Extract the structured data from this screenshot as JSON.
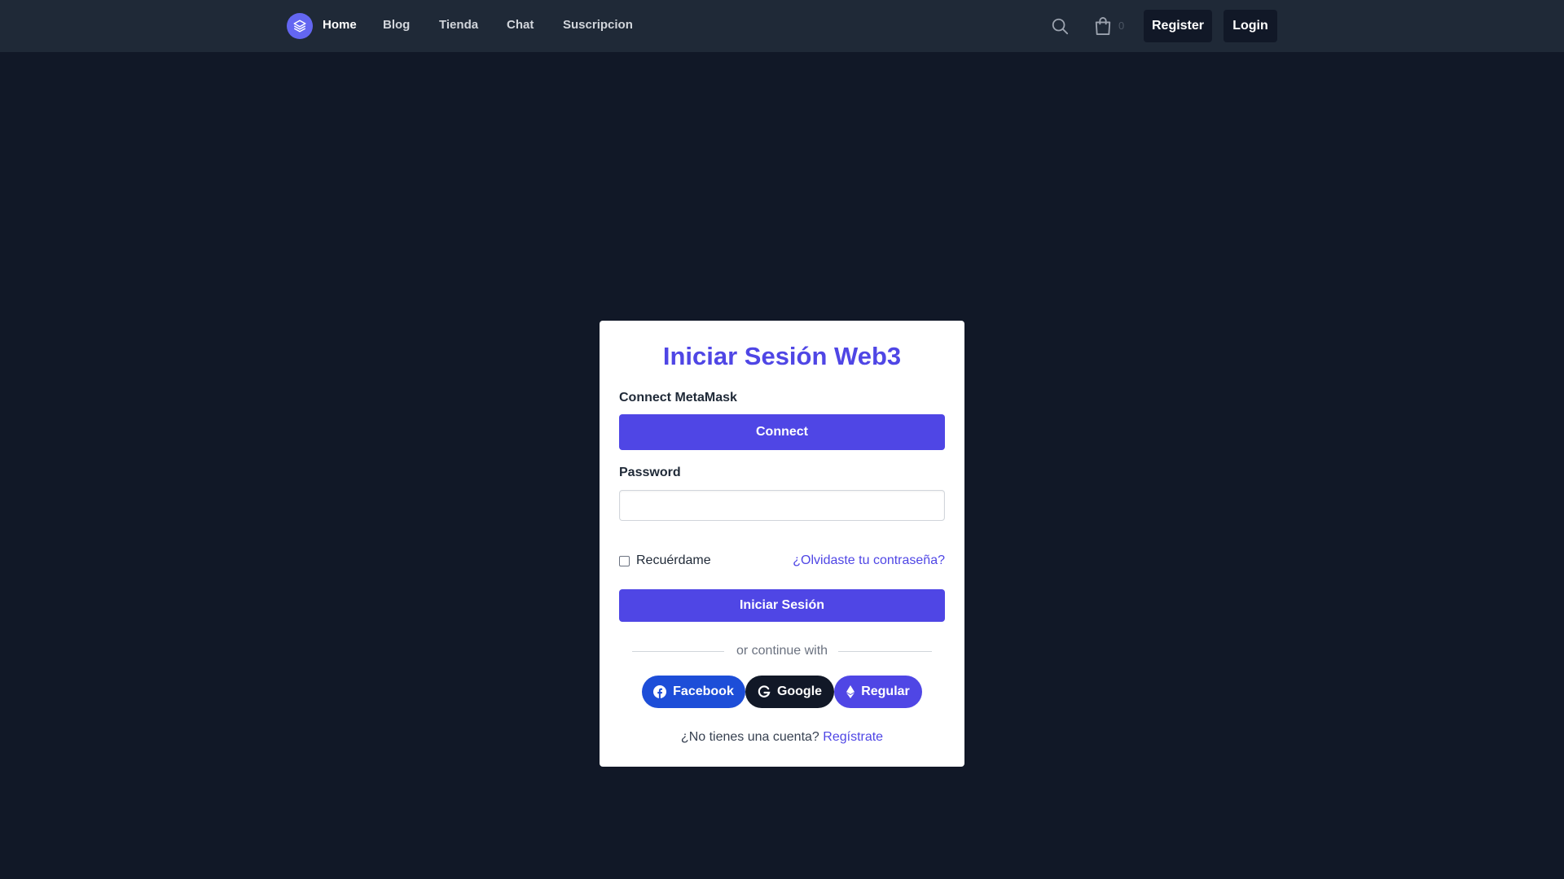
{
  "nav": {
    "links": [
      {
        "label": "Home",
        "active": true
      },
      {
        "label": "Blog",
        "active": false
      },
      {
        "label": "Tienda",
        "active": false
      },
      {
        "label": "Chat",
        "active": false
      },
      {
        "label": "Suscripcion",
        "active": false
      }
    ],
    "cart_count": "0",
    "register_label": "Register",
    "login_label": "Login",
    "icons": [
      "layers-icon",
      "search-icon",
      "shopping-bag-icon"
    ]
  },
  "login_card": {
    "title": "Iniciar Sesión Web3",
    "metamask_label": "Connect MetaMask",
    "connect_button": "Connect",
    "password_label": "Password",
    "password_value": "",
    "remember_label": "Recuérdame",
    "remember_checked": false,
    "forgot_link": "¿Olvidaste tu contraseña?",
    "submit_button": "Iniciar Sesión",
    "divider_text": "or continue with",
    "social": [
      {
        "label": "Facebook",
        "icon": "facebook-icon",
        "color": "#1d4ed8"
      },
      {
        "label": "Google",
        "icon": "google-icon",
        "color": "#111827"
      },
      {
        "label": "Regular",
        "icon": "ethereum-icon",
        "color": "#4f46e5"
      }
    ],
    "signup_prompt": "¿No tienes una cuenta?",
    "signup_link": "Regístrate"
  },
  "colors": {
    "background": "#111827",
    "navbar": "#1f2937",
    "accent": "#4f46e5",
    "logo": "#6366f1"
  }
}
